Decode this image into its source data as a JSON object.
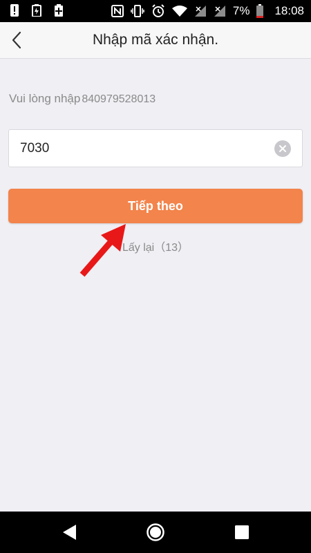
{
  "status_bar": {
    "battery_percent": "7%",
    "time": "18:08",
    "left_icons": [
      "alert-icon",
      "battery-saver-icon",
      "plus-icon"
    ],
    "right_icons": [
      "nfc-icon",
      "vibrate-icon",
      "alarm-icon",
      "wifi-icon",
      "signal-icon",
      "signal-icon",
      "battery-icon"
    ]
  },
  "header": {
    "title": "Nhập mã xác nhận.",
    "back_icon": "chevron-left-icon"
  },
  "form": {
    "hint_label": "Vui lòng nhập",
    "phone_number": "840979528013",
    "code_value": "7030",
    "clear_icon": "clear-icon",
    "next_button_label": "Tiếp theo",
    "resend_label": "Lấy lại（13）"
  },
  "colors": {
    "accent": "#f3844b",
    "annotation_arrow": "#e81818",
    "background": "#efeff4"
  },
  "nav_bar": {
    "icons": [
      "nav-back-icon",
      "nav-home-icon",
      "nav-recents-icon"
    ]
  }
}
